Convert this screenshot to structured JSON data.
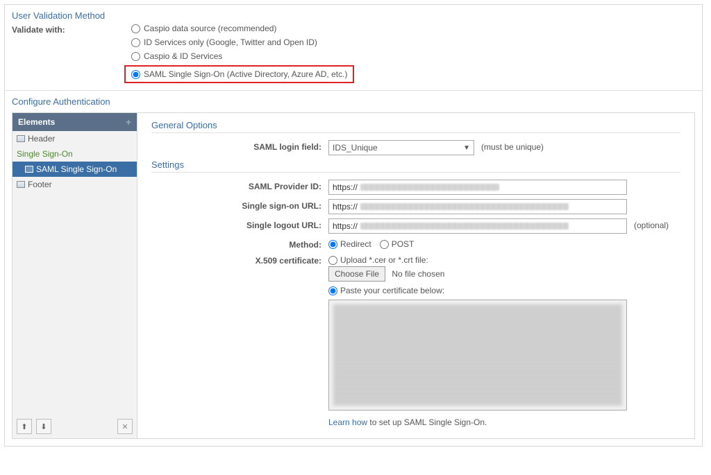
{
  "validation": {
    "title": "User Validation Method",
    "label": "Validate with:",
    "options": [
      "Caspio data source (recommended)",
      "ID Services only (Google, Twitter and Open ID)",
      "Caspio & ID Services",
      "SAML Single Sign-On (Active Directory, Azure AD, etc.)"
    ]
  },
  "configure": {
    "title": "Configure Authentication"
  },
  "sidebar": {
    "header": "Elements",
    "items": {
      "header": "Header",
      "sso": "Single Sign-On",
      "saml": "SAML Single Sign-On",
      "footer": "Footer"
    }
  },
  "pane": {
    "general": "General Options",
    "settings": "Settings",
    "login_field_label": "SAML login field:",
    "login_field_value": "IDS_Unique",
    "login_field_hint": "(must be unique)",
    "provider_id_label": "SAML Provider ID:",
    "signon_url_label": "Single sign-on URL:",
    "logout_url_label": "Single logout URL:",
    "logout_hint": "(optional)",
    "url_prefix": "https://",
    "method_label": "Method:",
    "method_redirect": "Redirect",
    "method_post": "POST",
    "cert_label": "X.509 certificate:",
    "cert_upload": "Upload *.cer or *.crt file:",
    "choose_file": "Choose File",
    "no_file": "No file chosen",
    "cert_paste": "Paste your certificate below:",
    "learn_link": "Learn how",
    "learn_text": " to set up SAML Single Sign-On."
  }
}
